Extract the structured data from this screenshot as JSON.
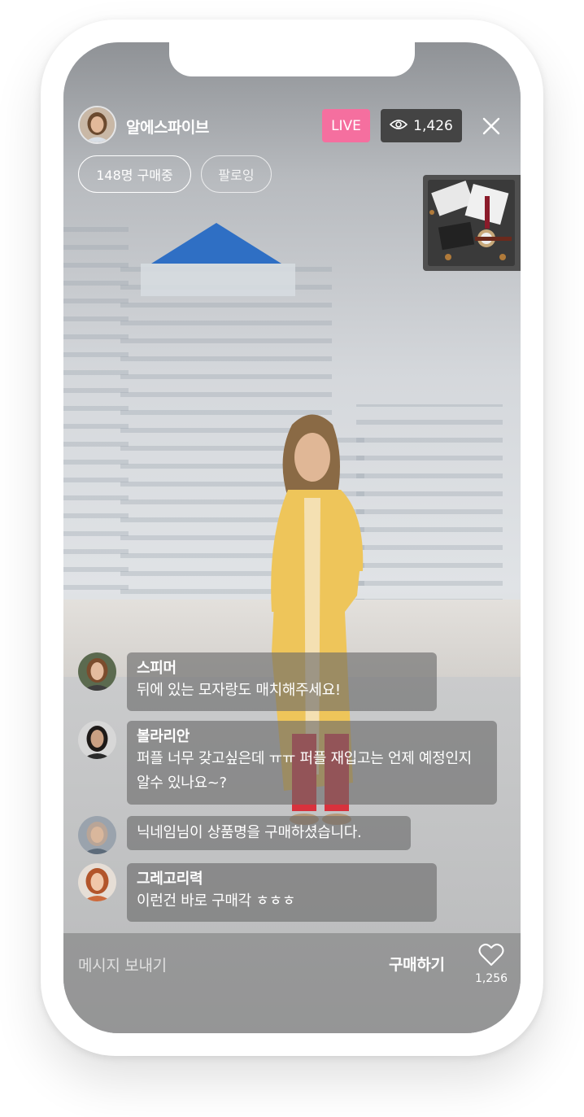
{
  "host": {
    "name": "알에스파이브"
  },
  "header": {
    "live_label": "LIVE",
    "viewer_count": "1,426"
  },
  "actions": {
    "buying_label": "148명 구매중",
    "follow_label": "팔로잉"
  },
  "chat": [
    {
      "nickname": "스피머",
      "message": "뒤에 있는 모자랑도 매치해주세요!"
    },
    {
      "nickname": "볼라리안",
      "message": "퍼플 너무 갖고싶은데 ㅠㅠ 퍼플 재입고는 언제 예정인지 알수 있나요~?"
    },
    {
      "nickname": "",
      "message": "닉네임님이 상품명을 구매하셨습니다."
    },
    {
      "nickname": "그레고리력",
      "message": "이런건 바로 구매각 ㅎㅎㅎ"
    }
  ],
  "bottom": {
    "message_placeholder": "메시지 보내기",
    "buy_label": "구매하기",
    "like_count": "1,256"
  },
  "colors": {
    "live_badge": "#f56f9f",
    "viewer_badge": "#444444",
    "chat_bubble": "#696969"
  },
  "icons": {
    "viewers": "eye-icon",
    "close": "close-icon",
    "like": "heart-icon"
  }
}
